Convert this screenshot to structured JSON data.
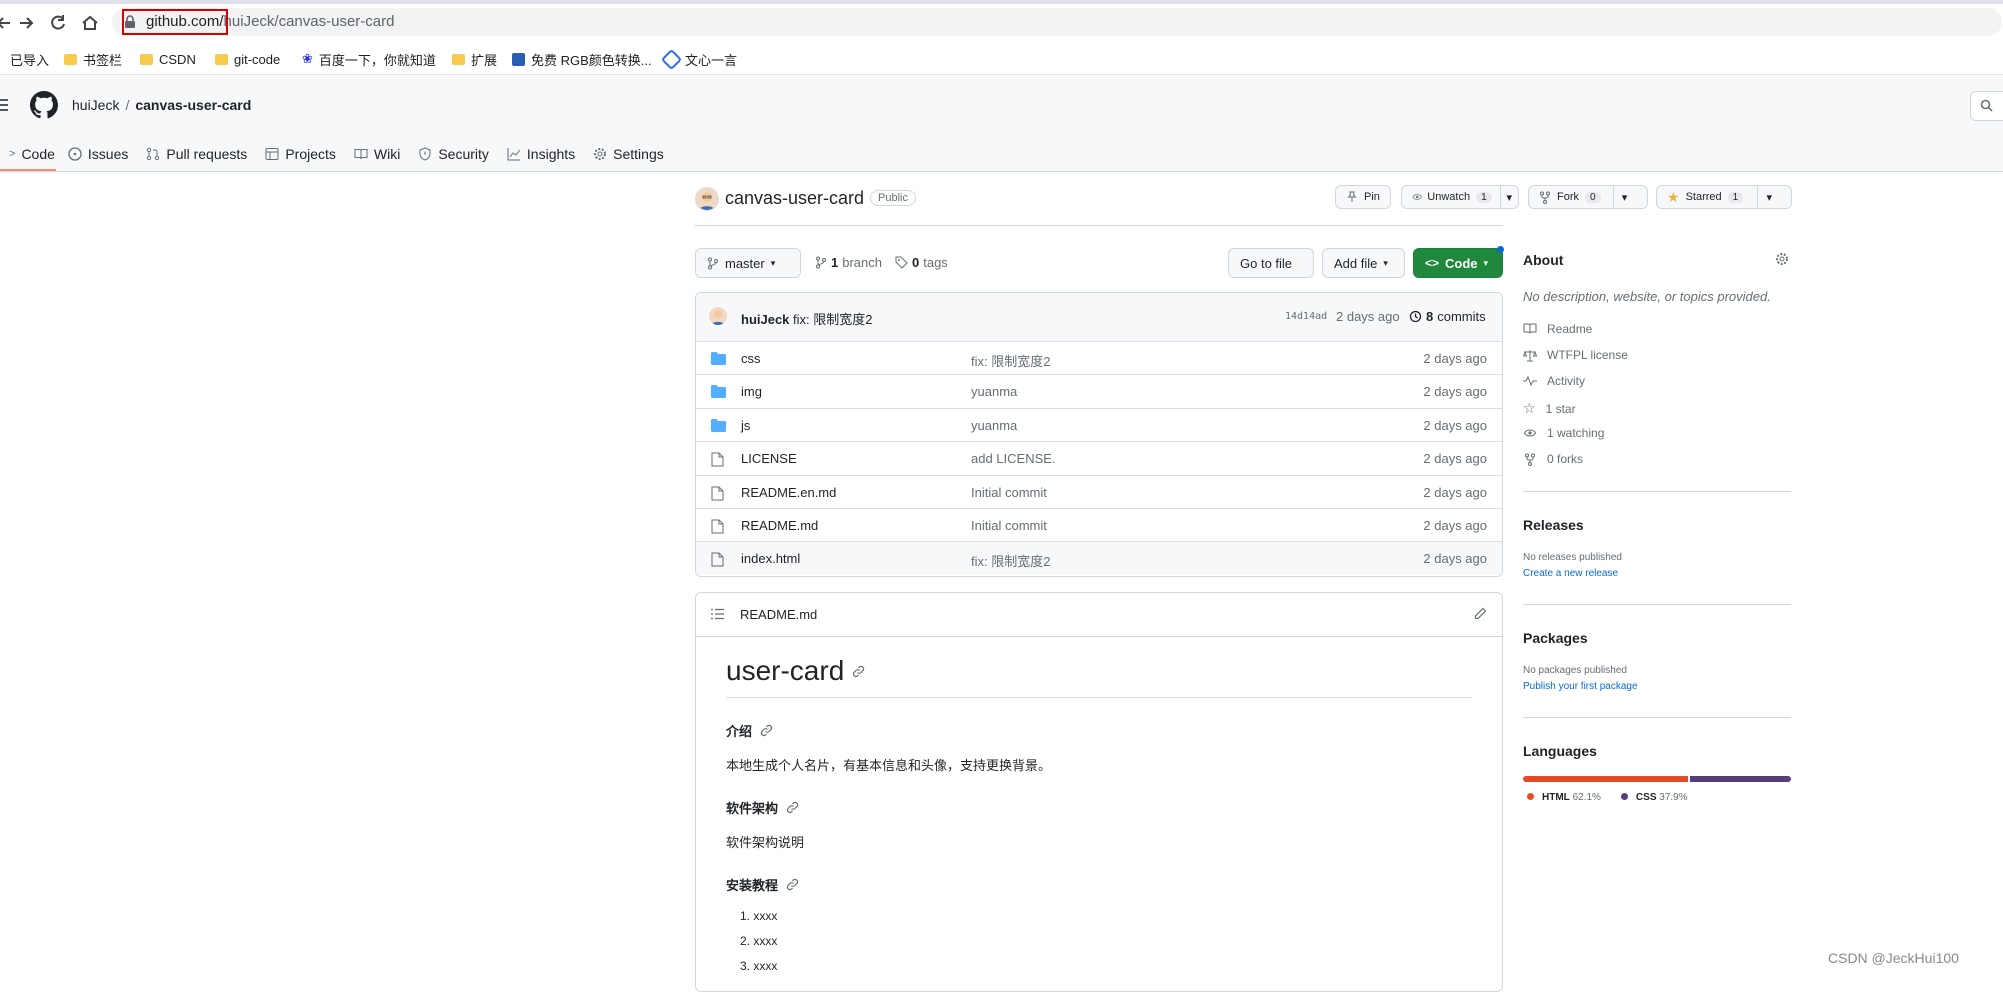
{
  "browser": {
    "url_host": "github.com/",
    "url_path": "huiJeck/canvas-user-card",
    "bookmarks": [
      "已导入",
      "书签栏",
      "CSDN",
      "git-code",
      "百度一下，你就知道",
      "扩展",
      "免费 RGB颜色转换...",
      "文心一言"
    ]
  },
  "header": {
    "owner": "huiJeck",
    "repo": "canvas-user-card",
    "nav": [
      "Code",
      "Issues",
      "Pull requests",
      "Projects",
      "Wiki",
      "Security",
      "Insights",
      "Settings"
    ]
  },
  "repo": {
    "name": "canvas-user-card",
    "visibility": "Public",
    "pin": "Pin",
    "unwatch": "Unwatch",
    "unwatch_count": "1",
    "fork": "Fork",
    "fork_count": "0",
    "starred": "Starred",
    "star_count": "1"
  },
  "branch_bar": {
    "branch": "master",
    "branches_num": "1",
    "branches_label": "branch",
    "tags_num": "0",
    "tags_label": "tags",
    "go_to_file": "Go to file",
    "add_file": "Add file",
    "code": "Code"
  },
  "commit": {
    "author": "huiJeck",
    "message": "fix: 限制宽度2",
    "sha": "14d14ad",
    "age": "2 days ago",
    "commits_num": "8",
    "commits_label": "commits"
  },
  "files": [
    {
      "name": "css",
      "type": "dir",
      "message": "fix: 限制宽度2",
      "age": "2 days ago"
    },
    {
      "name": "img",
      "type": "dir",
      "message": "yuanma",
      "age": "2 days ago"
    },
    {
      "name": "js",
      "type": "dir",
      "message": "yuanma",
      "age": "2 days ago"
    },
    {
      "name": "LICENSE",
      "type": "file",
      "message": "add LICENSE.",
      "age": "2 days ago"
    },
    {
      "name": "README.en.md",
      "type": "file",
      "message": "Initial commit",
      "age": "2 days ago"
    },
    {
      "name": "README.md",
      "type": "file",
      "message": "Initial commit",
      "age": "2 days ago"
    },
    {
      "name": "index.html",
      "type": "file",
      "message": "fix: 限制宽度2",
      "age": "2 days ago"
    }
  ],
  "readme": {
    "filename": "README.md",
    "h1": "user-card",
    "h_intro": "介绍",
    "p_intro": "本地生成个人名片，有基本信息和头像，支持更换背景。",
    "h_arch": "软件架构",
    "p_arch": "软件架构说明",
    "h_install": "安装教程",
    "list": [
      "1. xxxx",
      "2. xxxx",
      "3. xxxx"
    ]
  },
  "sidebar": {
    "about": "About",
    "about_desc": "No description, website, or topics provided.",
    "items": [
      "Readme",
      "WTFPL license",
      "Activity",
      "1 star",
      "1 watching",
      "0 forks"
    ],
    "releases": "Releases",
    "releases_none": "No releases published",
    "releases_link": "Create a new release",
    "packages": "Packages",
    "packages_none": "No packages published",
    "packages_link": "Publish your first package",
    "languages": "Languages",
    "langs": [
      {
        "name": "HTML",
        "pct": "62.1%",
        "value": 62.1,
        "color": "#e34c26"
      },
      {
        "name": "CSS",
        "pct": "37.9%",
        "value": 37.9,
        "color": "#563d7c"
      }
    ]
  },
  "watermark": "CSDN @JeckHui100"
}
